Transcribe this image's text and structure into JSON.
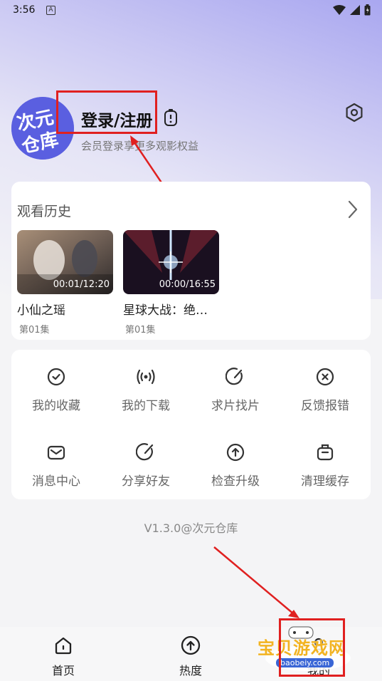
{
  "status_bar": {
    "time": "3:56",
    "notification_glyph": "A"
  },
  "profile": {
    "avatar_text": "次元仓库",
    "login_label": "登录/注册",
    "subtitle": "会员登录享更多观影权益"
  },
  "history": {
    "title": "观看历史",
    "items": [
      {
        "title": "小仙之瑶",
        "episode": "第01集",
        "time": "00:01/12:20"
      },
      {
        "title": "星球大战：绝…",
        "episode": "第01集",
        "time": "00:00/16:55"
      }
    ]
  },
  "menu": {
    "items": [
      {
        "label": "我的收藏",
        "icon": "check-circle-icon"
      },
      {
        "label": "我的下载",
        "icon": "broadcast-icon"
      },
      {
        "label": "求片找片",
        "icon": "edit-circle-icon"
      },
      {
        "label": "反馈报错",
        "icon": "close-circle-icon"
      },
      {
        "label": "消息中心",
        "icon": "mail-icon"
      },
      {
        "label": "分享好友",
        "icon": "share-icon"
      },
      {
        "label": "检查升级",
        "icon": "upgrade-icon"
      },
      {
        "label": "清理缓存",
        "icon": "clear-cache-icon"
      }
    ]
  },
  "version": "V1.3.0@次元仓库",
  "nav": {
    "items": [
      {
        "label": "首页",
        "icon": "home-icon"
      },
      {
        "label": "热度",
        "icon": "hot-icon"
      },
      {
        "label": "我的",
        "icon": "profile-icon"
      }
    ]
  },
  "watermark": {
    "text": "宝贝游戏网",
    "url": "baobeiy.com"
  },
  "colors": {
    "accent": "#5a5fe0",
    "annotation": "#e02020"
  }
}
